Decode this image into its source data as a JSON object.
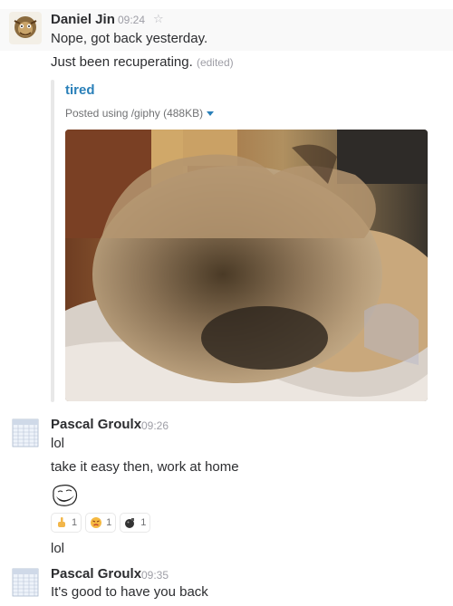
{
  "messages": [
    {
      "sender": "Daniel Jin",
      "time": "09:24",
      "lines": [
        "Nope, got back yesterday.",
        "Just been recuperating."
      ],
      "edited_label": "(edited)",
      "attachment": {
        "title": "tired",
        "meta_prefix": "Posted using /giphy ",
        "size": "(488KB)"
      }
    },
    {
      "sender": "Pascal Groulx",
      "time": "09:26",
      "lines": [
        "lol",
        "take it easy then, work at home",
        "lol"
      ],
      "reactions": [
        {
          "icon": "middle-finger-emoji",
          "count": "1"
        },
        {
          "icon": "angry-face-emoji",
          "count": "1"
        },
        {
          "icon": "bomb-emoji",
          "count": "1"
        }
      ]
    },
    {
      "sender": "Pascal Groulx",
      "time": "09:35",
      "lines": [
        "It's good to have you back"
      ]
    }
  ],
  "colors": {
    "link": "#2a80b9",
    "muted": "#9e9ea6",
    "text": "#2c2d30"
  }
}
